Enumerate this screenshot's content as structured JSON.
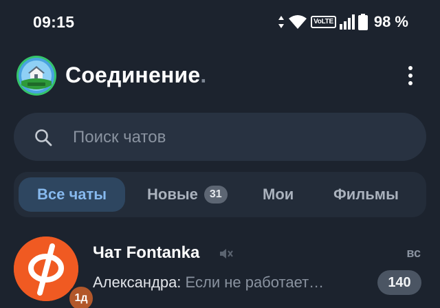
{
  "status_bar": {
    "time": "09:15",
    "network_label": "VoLTE",
    "battery_percent": "98 %",
    "icons": [
      "data-arrows-icon",
      "wifi-icon",
      "volte-icon",
      "signal-icon",
      "battery-icon"
    ]
  },
  "header": {
    "title": "Соединение",
    "title_suffix": ".",
    "avatar_icon": "house-logo-icon",
    "menu_icon": "more-vertical-icon"
  },
  "search": {
    "placeholder": "Поиск чатов",
    "icon": "search-icon"
  },
  "tabs": [
    {
      "label": "Все чаты",
      "active": true
    },
    {
      "label": "Новые",
      "badge": "31"
    },
    {
      "label": "Мои"
    },
    {
      "label": "Фильмы"
    }
  ],
  "chats": [
    {
      "name": "Чат Fontanka",
      "muted": true,
      "time": "вс",
      "folder_badge": "1д",
      "sender": "Александра:",
      "message": " Если не работает…",
      "unread": "140",
      "avatar_color": "#f05a22"
    }
  ],
  "colors": {
    "background": "#1c232e",
    "search_bg": "#283241",
    "tab_active_bg": "#2e4660",
    "tab_active_text": "#87b9ee",
    "muted_text": "#8a93a0"
  }
}
